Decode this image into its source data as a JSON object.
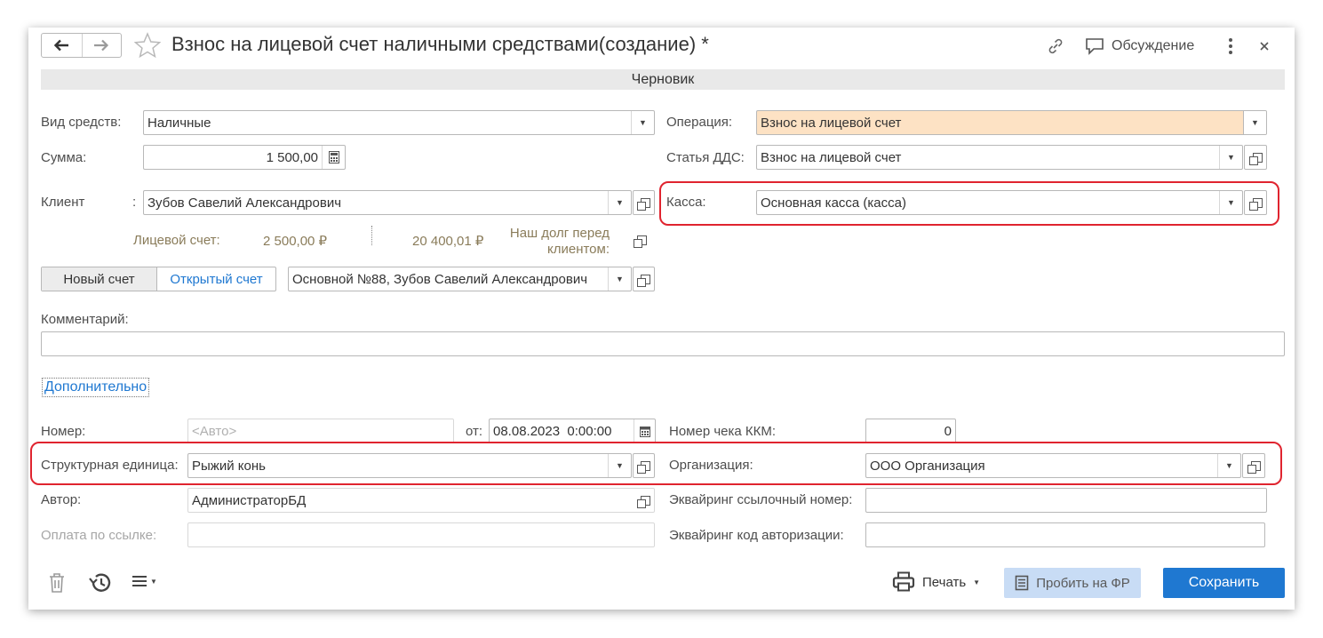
{
  "header": {
    "title": "Взнос на лицевой счет наличными средствами(создание) *",
    "discussion_label": "Обсуждение",
    "status_bar": "Черновик"
  },
  "form": {
    "vid_sredstv": {
      "label": "Вид средств:",
      "value": "Наличные"
    },
    "summa": {
      "label": "Сумма:",
      "value": "1 500,00"
    },
    "client": {
      "label": "Клиент",
      "value": "Зубов Савелий Александрович"
    },
    "licevoy": {
      "label": "Лицевой счет:",
      "amount1": "2 500,00 ₽",
      "amount2": "20 400,01 ₽",
      "debt_line1": "Наш долг перед",
      "debt_line2": "клиентом:"
    },
    "account_buttons": {
      "new": "Новый счет",
      "open": "Открытый счет"
    },
    "account": {
      "value": "Основной №88, Зубов Савелий Александрович"
    },
    "operation": {
      "label": "Операция:",
      "value": "Взнос на лицевой счет"
    },
    "statya": {
      "label": "Статья ДДС:",
      "value": "Взнос на лицевой счет"
    },
    "kassa": {
      "label": "Касса:",
      "value": "Основная касса (касса)"
    },
    "comment": {
      "label": "Комментарий:",
      "value": ""
    },
    "additional_link": "Дополнительно"
  },
  "additional": {
    "nomer": {
      "label": "Номер:",
      "placeholder": "<Авто>"
    },
    "ot": {
      "label": "от:",
      "value": "08.08.2023  0:00:00"
    },
    "nomer_cheka": {
      "label": "Номер чека ККМ:",
      "value": "0"
    },
    "struct": {
      "label": "Структурная единица:",
      "value": "Рыжий конь"
    },
    "org": {
      "label": "Организация:",
      "value": "ООО Организация"
    },
    "avtor": {
      "label": "Автор:",
      "value": "АдминистраторБД"
    },
    "oplata": {
      "label": "Оплата по ссылке:",
      "value": ""
    },
    "ekv_ref": {
      "label": "Эквайринг ссылочный номер:",
      "value": ""
    },
    "ekv_auth": {
      "label": "Эквайринг код авторизации:",
      "value": ""
    }
  },
  "footer": {
    "print_label": "Печать",
    "fr_label": "Пробить на ФР",
    "save_label": "Сохранить"
  },
  "colors": {
    "accent": "#1f78d1",
    "save_bg": "#1f78d1",
    "fr_bg": "#c8dcf5",
    "orange_field": "#fde2c4",
    "highlight_frame": "#e0242f",
    "status_bar_bg": "#e9e9e9"
  }
}
